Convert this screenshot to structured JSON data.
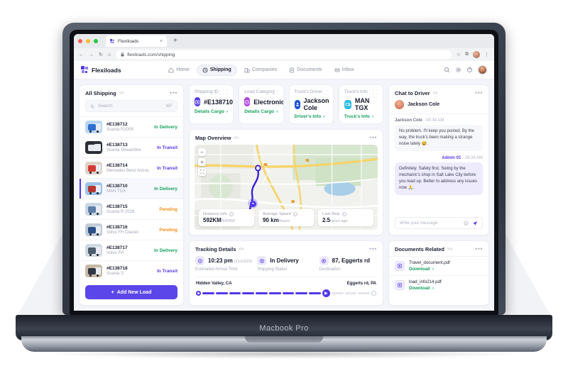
{
  "device": {
    "label": "Macbook Pro"
  },
  "browser": {
    "tab_title": "Flexiloads",
    "tab_close": "×",
    "new_tab": "+",
    "url": "flexiloads.com/shipping",
    "lock_icon": "lock-icon",
    "back": "←",
    "forward": "→",
    "reload": "↻",
    "home": "⌂",
    "star": "☆",
    "extensions": "⧉",
    "menu": "⋮"
  },
  "header": {
    "brand": "Flexiloads",
    "nav": [
      {
        "label": "Home",
        "icon": "home-icon",
        "active": false
      },
      {
        "label": "Shipping",
        "icon": "clock-icon",
        "active": true
      },
      {
        "label": "Companies",
        "icon": "building-icon",
        "active": false
      },
      {
        "label": "Documents",
        "icon": "document-icon",
        "active": false
      },
      {
        "label": "Inbox",
        "icon": "mail-icon",
        "active": false
      }
    ],
    "actions": [
      {
        "icon": "search-icon"
      },
      {
        "icon": "gear-icon"
      },
      {
        "icon": "help-icon"
      }
    ],
    "avatar": "user-avatar"
  },
  "shipping_panel": {
    "title": "All Shipping",
    "code_badge": "<>",
    "more": "•••",
    "search_placeholder": "Search",
    "search_shortcut": "⌘F",
    "add_button": "Add New Load",
    "add_icon": "+",
    "items": [
      {
        "id": "#E138712",
        "model": "Scania R2009",
        "status": "In Delivery",
        "status_key": "delivery",
        "selected": false,
        "cab": "#2f6fd0",
        "sky": "#b9d7f2"
      },
      {
        "id": "#E138713",
        "model": "Scania Streamline",
        "status": "In Transit",
        "status_key": "transit",
        "selected": false,
        "cab": "#e7eaef",
        "sky": "#2c3138"
      },
      {
        "id": "#E138714",
        "model": "Mercedes Benz Actros",
        "status": "In Transit",
        "status_key": "transit",
        "selected": false,
        "cab": "#d33b35",
        "sky": "#dfd2c4"
      },
      {
        "id": "#E138710",
        "model": "MAN TGX",
        "status": "In Delivery",
        "status_key": "delivery",
        "selected": true,
        "cab": "#b5372f",
        "sky": "#9dc4e8"
      },
      {
        "id": "#E138715",
        "model": "Scania R 2016",
        "status": "Pending",
        "status_key": "pending",
        "selected": false,
        "cab": "#5d7fa8",
        "sky": "#c9d7e4"
      },
      {
        "id": "#E138716",
        "model": "Volvo FH Classic",
        "status": "Pending",
        "status_key": "pending",
        "selected": false,
        "cab": "#2b4f86",
        "sky": "#c2ccd8"
      },
      {
        "id": "#E138717",
        "model": "Volvo FH",
        "status": "In Delivery",
        "status_key": "delivery",
        "selected": false,
        "cab": "#4c5d6d",
        "sky": "#cfd9e2"
      },
      {
        "id": "#E138718",
        "model": "Scania S",
        "status": "In Transit",
        "status_key": "transit",
        "selected": false,
        "cab": "#2e3742",
        "sky": "#c7b9a6"
      }
    ]
  },
  "stat_cards": [
    {
      "label": "Shipping ID",
      "value": "#E138710",
      "link": "Details Cargo",
      "icon": "box-icon",
      "icon_bg": "#4f39e8"
    },
    {
      "label": "Load Category",
      "value": "Electronic",
      "link": "Details Cargo",
      "icon": "chip-icon",
      "icon_bg": "#b041e0"
    },
    {
      "label": "Truck's Driver",
      "value": "Jackson Cole",
      "link": "Driver's Info",
      "icon": "user-icon",
      "icon_bg": "#1d54d6"
    },
    {
      "label": "Truck's Info",
      "value": "MAN TGX",
      "link": "Truck's Info",
      "icon": "truck-icon",
      "icon_bg": "#2bbbe8"
    }
  ],
  "map": {
    "title": "Map Overview",
    "code_badge": "<>",
    "more": "•••",
    "controls": {
      "zoom_out": "−",
      "zoom_in": "+",
      "fullscreen": "⛶"
    },
    "stats": [
      {
        "label": "Distance Info",
        "value": "592KM",
        "unit": "/640KM"
      },
      {
        "label": "Average Speed",
        "value": "90 km",
        "unit": "/hours"
      },
      {
        "label": "Last Stop",
        "value": "2.5",
        "unit": "hours ago"
      }
    ]
  },
  "tracking": {
    "title": "Tracking Details",
    "code_badge": "<>",
    "more": "•••",
    "stats": [
      {
        "value": "10:23 pm",
        "meta": "(21/12/23)",
        "sub": "Estimated Arrival Time",
        "icon": "clock-icon"
      },
      {
        "value": "In Delivery",
        "meta": "",
        "sub": "Shipping Status",
        "icon": "status-icon"
      },
      {
        "value": "87, Eggerts rd",
        "meta": "",
        "sub": "Destination",
        "icon": "pin-icon"
      }
    ],
    "origin": "Hidden Valley, CA",
    "destination": "Eggerts rd, PA",
    "progress_segments_on": 9,
    "progress_segments_off": 3,
    "truck_icon": "truck-marker-icon"
  },
  "chat": {
    "title": "Chat to Driver",
    "code_badge": "<>",
    "more": "•••",
    "contact": "Jackson Cole",
    "messages": [
      {
        "author": "Jackson Cole",
        "time": "08:34 AM",
        "text": "No problem. I'll keep you posted. By the way, the truck's been making a strange noise lately 😅.",
        "direction": "in"
      },
      {
        "author": "Admin 01",
        "time": "08:34 AM",
        "text": "Definitely. Safety first. Swing by the mechanic's shop in Salt Lake City before you load up. Better to address any issues now 🙏.",
        "direction": "out"
      }
    ],
    "input_placeholder": "Write your message",
    "emoji_icon": "emoji-icon",
    "send_icon": "send-icon"
  },
  "documents": {
    "title": "Documents Related",
    "code_badge": "<>",
    "more": "•••",
    "items": [
      {
        "name": "Travel_document.pdf",
        "action": "Download",
        "icon": "pdf-icon"
      },
      {
        "name": "load_info214.pdf",
        "action": "Download",
        "icon": "pdf-icon"
      }
    ]
  },
  "colors": {
    "accent": "#4f39e8",
    "success": "#13a05c",
    "warning": "#f09018",
    "bg": "#f4f5fa"
  }
}
